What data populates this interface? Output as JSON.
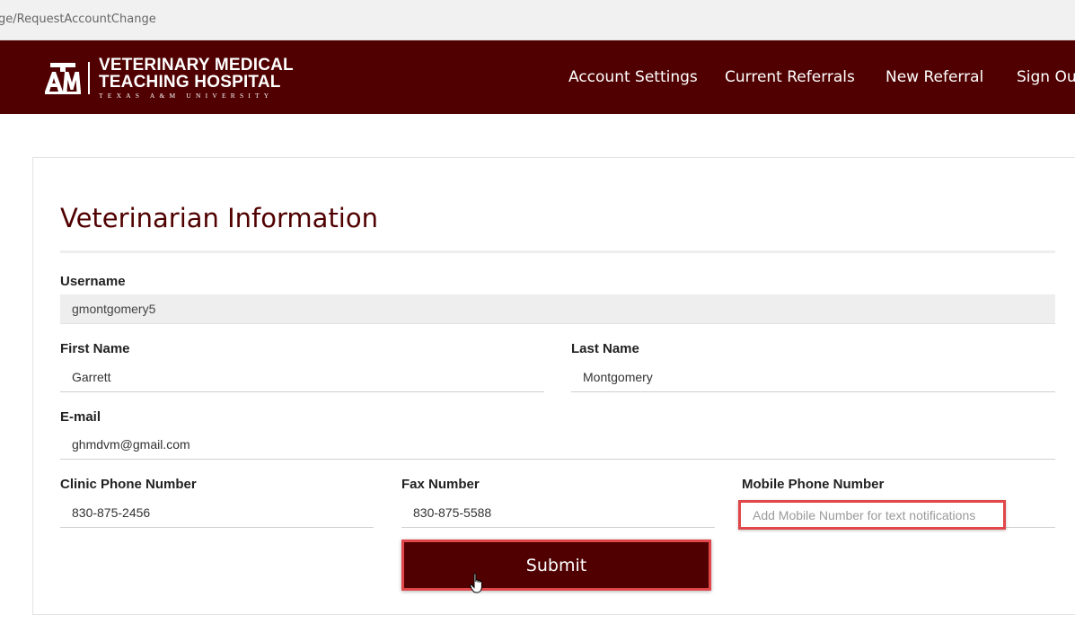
{
  "browser": {
    "url": "ge/RequestAccountChange"
  },
  "header": {
    "logo": {
      "mark": "ATM",
      "line1": "VETERINARY MEDICAL",
      "line2": "TEACHING HOSPITAL",
      "line3": "TEXAS A&M UNIVERSITY"
    },
    "nav": [
      {
        "label": "Account Settings"
      },
      {
        "label": "Current Referrals"
      },
      {
        "label": "New Referral"
      },
      {
        "label": "Sign Out"
      }
    ],
    "brand_color": "#500000"
  },
  "form": {
    "title": "Veterinarian Information",
    "username": {
      "label": "Username",
      "value": "gmontgomery5"
    },
    "first_name": {
      "label": "First Name",
      "value": "Garrett"
    },
    "last_name": {
      "label": "Last Name",
      "value": "Montgomery"
    },
    "email": {
      "label": "E-mail",
      "value": "ghmdvm@gmail.com"
    },
    "clinic_phone": {
      "label": "Clinic Phone Number",
      "value": "830-875-2456"
    },
    "fax": {
      "label": "Fax Number",
      "value": "830-875-5588"
    },
    "mobile_phone": {
      "label": "Mobile Phone Number",
      "value": "",
      "placeholder": "Add Mobile Number for text notifications"
    },
    "submit_label": "Submit",
    "highlight_color": "#e0464a"
  }
}
